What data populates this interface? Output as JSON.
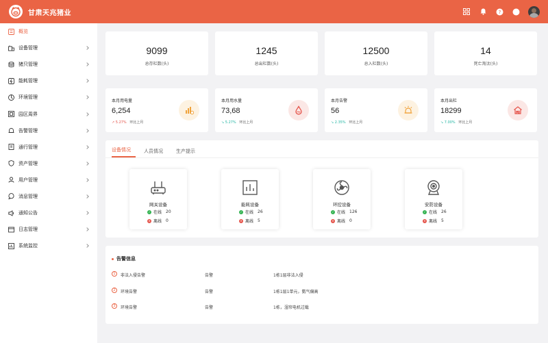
{
  "app": {
    "title": "甘肃天兆猪业"
  },
  "topbar": {
    "icons": [
      "grid-icon",
      "bell-icon",
      "help-icon",
      "compass-icon"
    ]
  },
  "sidebar": {
    "items": [
      {
        "label": "概览",
        "icon": "overview-icon",
        "active": true
      },
      {
        "label": "设备管理",
        "icon": "device-icon"
      },
      {
        "label": "猪只管理",
        "icon": "database-icon"
      },
      {
        "label": "能耗管理",
        "icon": "energy-icon"
      },
      {
        "label": "环境管理",
        "icon": "environment-icon"
      },
      {
        "label": "园区周界",
        "icon": "perimeter-icon"
      },
      {
        "label": "告警管理",
        "icon": "alarm-icon"
      },
      {
        "label": "通行管理",
        "icon": "access-icon"
      },
      {
        "label": "资产管理",
        "icon": "shield-icon"
      },
      {
        "label": "用户管理",
        "icon": "user-icon"
      },
      {
        "label": "消息管理",
        "icon": "message-icon"
      },
      {
        "label": "通知公告",
        "icon": "notice-icon"
      },
      {
        "label": "日志管理",
        "icon": "log-icon"
      },
      {
        "label": "系统监控",
        "icon": "monitor-icon"
      }
    ]
  },
  "stats": [
    {
      "value": "9099",
      "label": "总存栏数(头)"
    },
    {
      "value": "1245",
      "label": "总出栏数(头)"
    },
    {
      "value": "12500",
      "label": "总入栏数(头)"
    },
    {
      "value": "14",
      "label": "死亡淘汰(头)"
    }
  ],
  "metrics": [
    {
      "title": "本月用电量",
      "value": "6,254",
      "trend": "5.27%",
      "trend_dir": "up",
      "compare": "环比上月",
      "icon": "chart-icon",
      "color": "#f0a23a",
      "bg": "#fdf2e1"
    },
    {
      "title": "本月用水量",
      "value": "73,68",
      "trend": "5.27%",
      "trend_dir": "down",
      "compare": "环比上月",
      "icon": "water-drop-icon",
      "color": "#e5544b",
      "bg": "#fbe7e5"
    },
    {
      "title": "本月告警",
      "value": "56",
      "trend": "2.35%",
      "trend_dir": "down",
      "compare": "环比上月",
      "icon": "sun-alarm-icon",
      "color": "#f0a23a",
      "bg": "#fdf2e1"
    },
    {
      "title": "本月出栏",
      "value": "18299",
      "trend": "7.00%",
      "trend_dir": "down",
      "compare": "环比上月",
      "icon": "barn-icon",
      "color": "#e5544b",
      "bg": "#fbe7e5"
    }
  ],
  "tabs": [
    {
      "label": "设备情况",
      "active": true
    },
    {
      "label": "人员情况"
    },
    {
      "label": "生产提示"
    }
  ],
  "devices": [
    {
      "name": "网关设备",
      "icon": "gateway-icon",
      "online_label": "在线",
      "online": "20",
      "offline_label": "离线",
      "offline": "0"
    },
    {
      "name": "能耗设备",
      "icon": "energy-chart-icon",
      "online_label": "在线",
      "online": "26",
      "offline_label": "离线",
      "offline": "5"
    },
    {
      "name": "环控设备",
      "icon": "fan-icon",
      "online_label": "在线",
      "online": "126",
      "offline_label": "离线",
      "offline": "0"
    },
    {
      "name": "安防设备",
      "icon": "camera-icon",
      "online_label": "在线",
      "online": "26",
      "offline_label": "离线",
      "offline": "5"
    }
  ],
  "alarms": {
    "title": "告警信息",
    "items": [
      {
        "num": "1",
        "name": "非法入侵告警",
        "type": "告警",
        "desc": "1栋1层非法入侵"
      },
      {
        "num": "2",
        "name": "环境告警",
        "type": "告警",
        "desc": "1栋1层1单元，氨气偏高"
      },
      {
        "num": "3",
        "name": "环境告警",
        "type": "告警",
        "desc": "1栋，湿帘电机过载"
      }
    ]
  },
  "colors": {
    "brand": "#ea6445",
    "online": "#34b352",
    "offline": "#e5544b"
  }
}
